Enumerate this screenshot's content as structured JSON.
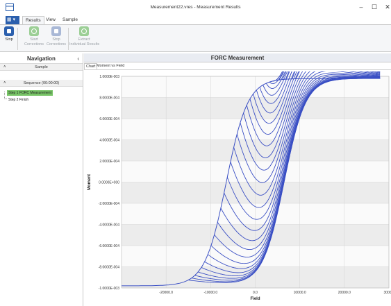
{
  "window": {
    "title": "Measurement22.vres - Measurement Results",
    "minimize": "–",
    "maximize": "☐",
    "close": "✕"
  },
  "ribbon": {
    "file_glyph": "▦ ▾",
    "tabs": [
      {
        "label": "Results",
        "active": true
      },
      {
        "label": "View",
        "active": false
      },
      {
        "label": "Sample",
        "active": false
      }
    ],
    "buttons": {
      "stop": "Stop",
      "start_corrections": "Start\nCorrections",
      "stop_corrections": "Stop\nCorrections",
      "extract": "Extract\nIndividual Results"
    }
  },
  "navigation": {
    "title": "Navigation",
    "collapse_glyph": "‹",
    "sample_section": "Sample",
    "sequence_section": "Sequence (00:00:00)",
    "steps": [
      {
        "label": "Step 1 FORC Measurement",
        "selected": true
      },
      {
        "label": "Step 2 Finish",
        "selected": false
      }
    ]
  },
  "main": {
    "title": "FORC Measurement",
    "subtabs": [
      {
        "label": "Chart",
        "active": true
      },
      {
        "label": "Moment vs Field",
        "active": false
      }
    ]
  },
  "colors": {
    "curve": "#3a4fc4",
    "accent": "#2b5fad",
    "selected": "#77c466"
  },
  "chart_data": {
    "type": "line",
    "title": "",
    "xlabel": "Field",
    "ylabel": "Moment",
    "xlim": [
      -30000,
      30000
    ],
    "ylim": [
      -0.001,
      0.001
    ],
    "grid": true,
    "x_ticks": [
      "-20000.0",
      "-10000.0",
      "0.0",
      "10000.0",
      "20000.0",
      "3000"
    ],
    "y_ticks": [
      "1.0000E-003",
      "8.0000E-004",
      "6.0000E-004",
      "4.0000E-004",
      "2.0000E-004",
      "0.0000E+000",
      "-2.0000E-004",
      "-4.0000E-004",
      "-6.0000E-004",
      "-8.0000E-004",
      "-1.0000E-003"
    ],
    "curve_family": "first-order reversal curves",
    "reversal_field_start": -15000,
    "reversal_field_end": 9000,
    "curve_count": 34,
    "saturation_field": 28000
  }
}
